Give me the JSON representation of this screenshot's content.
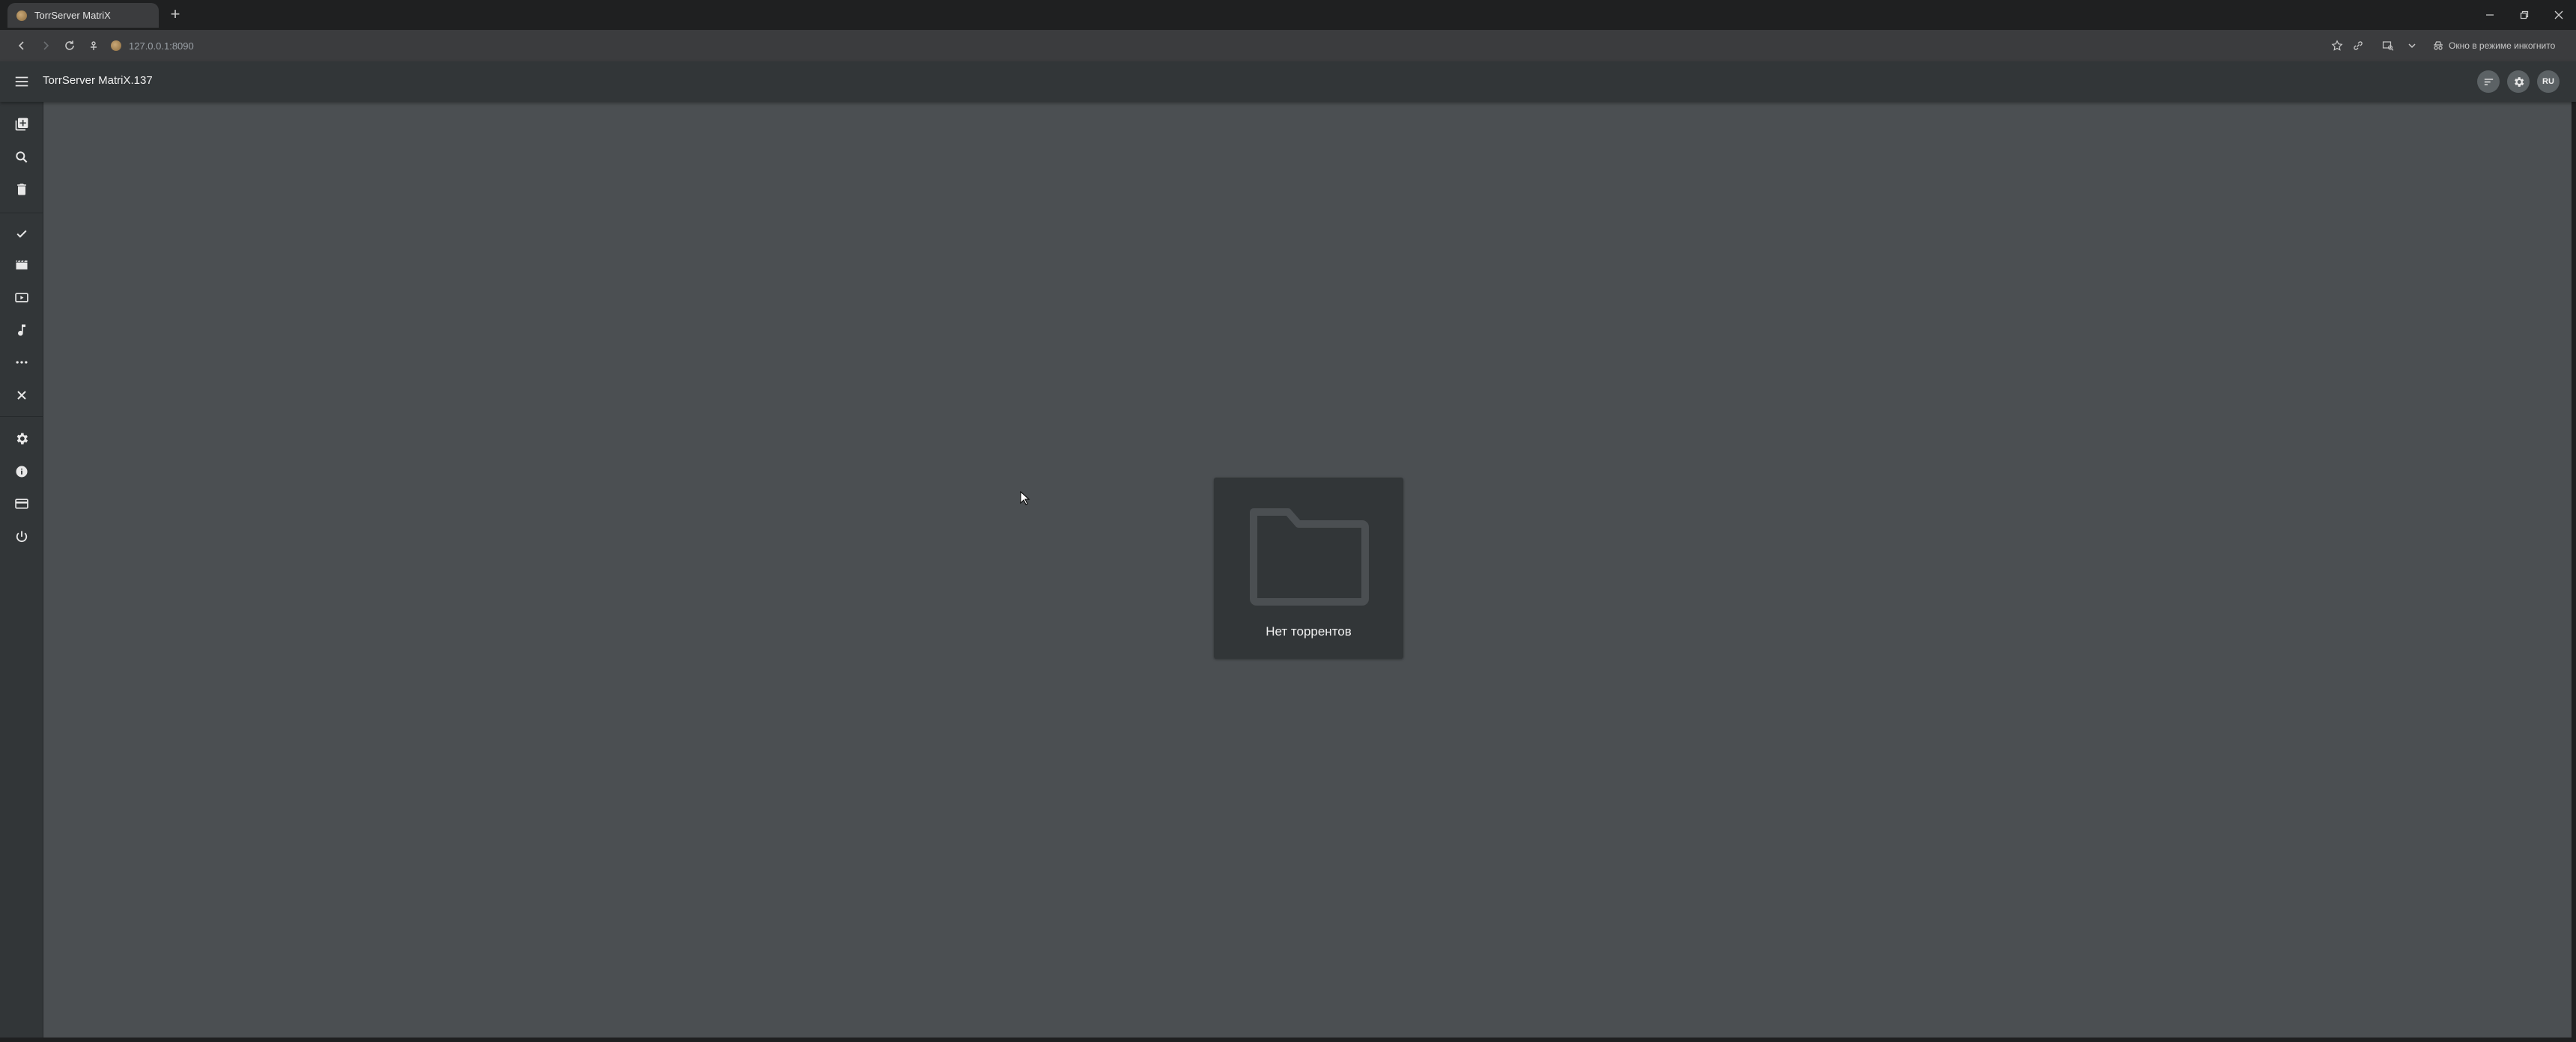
{
  "browser": {
    "tab_title": "TorrServer MatriX",
    "url": "127.0.0.1:8090",
    "incognito_label": "Окно в режиме инкогнито"
  },
  "app": {
    "title": "TorrServer MatriX.137",
    "language_button": "RU"
  },
  "sidebar": {
    "items": [
      {
        "icon": "add-library-icon"
      },
      {
        "icon": "search-icon"
      },
      {
        "icon": "trash-icon"
      },
      {
        "icon": "check-icon"
      },
      {
        "icon": "movie-icon"
      },
      {
        "icon": "tv-icon"
      },
      {
        "icon": "music-icon"
      },
      {
        "icon": "more-icon"
      },
      {
        "icon": "close-icon"
      },
      {
        "icon": "settings-icon"
      },
      {
        "icon": "info-icon"
      },
      {
        "icon": "card-icon"
      },
      {
        "icon": "power-icon"
      }
    ]
  },
  "main": {
    "empty_message": "Нет торрентов"
  },
  "colors": {
    "background": "#4b4f52",
    "appbar": "#323638",
    "card": "#323638",
    "folder_icon": "#4b4f52"
  }
}
